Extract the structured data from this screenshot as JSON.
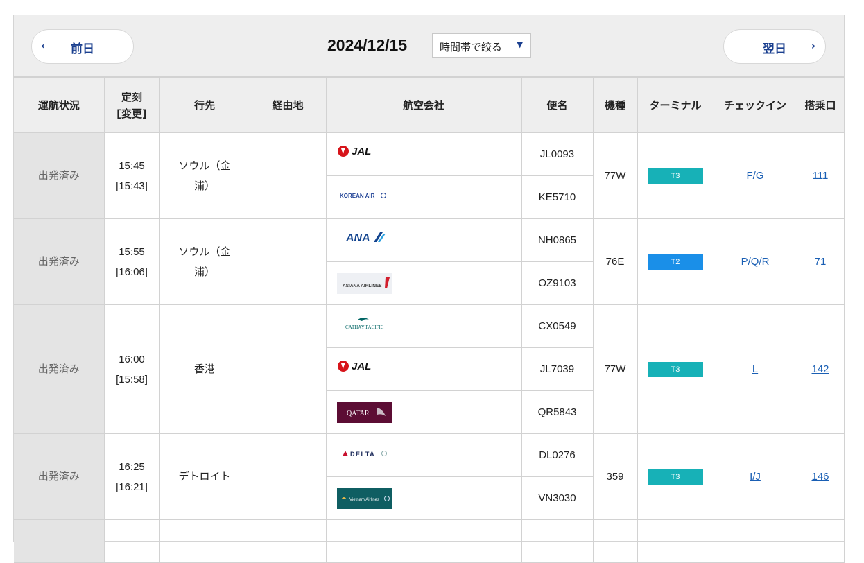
{
  "nav": {
    "prev_label": "前日",
    "next_label": "翌日",
    "date": "2024/12/15",
    "time_filter_label": "時間帯で絞る"
  },
  "columns": {
    "status": "運航状況",
    "scheduled": "定刻",
    "scheduled_changed": "[変更]",
    "destination": "行先",
    "via": "経由地",
    "airline": "航空会社",
    "flight": "便名",
    "aircraft": "機種",
    "terminal": "ターミナル",
    "checkin": "チェックイン",
    "gate": "搭乗口"
  },
  "flights": [
    {
      "status": "出発済み",
      "scheduled": "15:45",
      "changed": "[15:43]",
      "destination_line1": "ソウル（金",
      "destination_line2": "浦）",
      "via": "",
      "carriers": [
        {
          "logo": "jal-logo",
          "logo_text": "JAL",
          "flight": "JL0093"
        },
        {
          "logo": "korean-air-logo",
          "logo_text": "KOREAN AIR",
          "flight": "KE5710"
        }
      ],
      "aircraft": "77W",
      "terminal": "T3",
      "terminal_color": "#17b1b7",
      "checkin": "F/G",
      "gate": "111"
    },
    {
      "status": "出発済み",
      "scheduled": "15:55",
      "changed": "[16:06]",
      "destination_line1": "ソウル（金",
      "destination_line2": "浦）",
      "via": "",
      "carriers": [
        {
          "logo": "ana-logo",
          "logo_text": "ANA",
          "flight": "NH0865"
        },
        {
          "logo": "asiana-airlines-logo",
          "logo_text": "ASIANA AIRLINES",
          "flight": "OZ9103"
        }
      ],
      "aircraft": "76E",
      "terminal": "T2",
      "terminal_color": "#1a8fe8",
      "checkin": "P/Q/R",
      "gate": "71"
    },
    {
      "status": "出発済み",
      "scheduled": "16:00",
      "changed": "[15:58]",
      "destination_line1": "香港",
      "destination_line2": "",
      "via": "",
      "carriers": [
        {
          "logo": "cathay-pacific-logo",
          "logo_text": "CATHAY PACIFIC",
          "flight": "CX0549"
        },
        {
          "logo": "jal-logo",
          "logo_text": "JAL",
          "flight": "JL7039"
        },
        {
          "logo": "qatar-airways-logo",
          "logo_text": "QATAR",
          "flight": "QR5843"
        }
      ],
      "aircraft": "77W",
      "terminal": "T3",
      "terminal_color": "#17b1b7",
      "checkin": "L",
      "gate": "142"
    },
    {
      "status": "出発済み",
      "scheduled": "16:25",
      "changed": "[16:21]",
      "destination_line1": "デトロイト",
      "destination_line2": "",
      "via": "",
      "carriers": [
        {
          "logo": "delta-logo",
          "logo_text": "DELTA",
          "flight": "DL0276"
        },
        {
          "logo": "vietnam-airlines-logo",
          "logo_text": "Vietnam Airlines",
          "flight": "VN3030"
        }
      ],
      "aircraft": "359",
      "terminal": "T3",
      "terminal_color": "#17b1b7",
      "checkin": "I/J",
      "gate": "146"
    }
  ],
  "colors": {
    "accent": "#1a3f8f",
    "link": "#1a5fb4",
    "header_bg": "#eeeeee",
    "status_bg": "#e4e4e4"
  }
}
